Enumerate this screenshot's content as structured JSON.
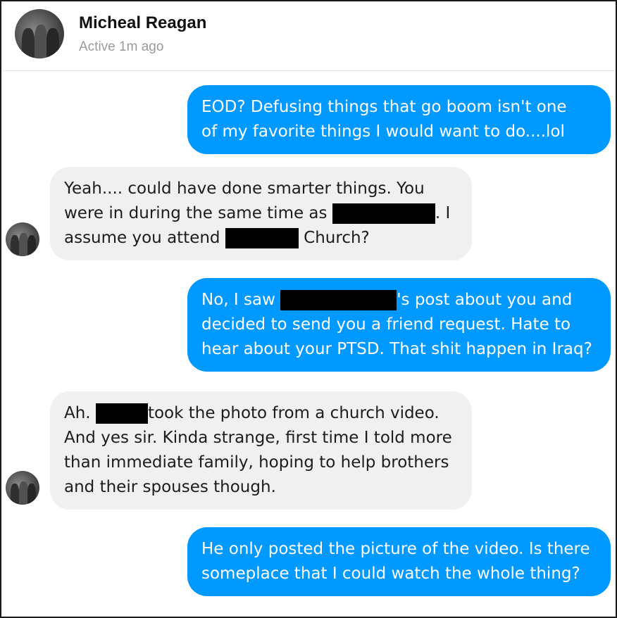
{
  "contact": {
    "name": "Micheal Reagan",
    "status": "Active 1m ago"
  },
  "messages": [
    {
      "direction": "sent",
      "lines": [
        "EOD? Defusing things that go boom  isn't one",
        "of my favorite things I would want to do....lol"
      ]
    },
    {
      "direction": "received",
      "parts": {
        "l1": "Yeah.... could have done smarter things. You",
        "l2a": "were in during the same time as ",
        "l2b": ". I",
        "l3a": "assume you attend ",
        "l3b": " Church?"
      }
    },
    {
      "direction": "sent",
      "parts": {
        "l1a": "No, I saw ",
        "l1b": "'s post about you and",
        "l2": "decided to send you a friend request. Hate to",
        "l3": "hear about your PTSD. That shit happen in Iraq?"
      }
    },
    {
      "direction": "received",
      "parts": {
        "l1a": "Ah. ",
        "l1b": "took the photo from a church video.",
        "l2": "And yes sir. Kinda strange, first time I told more",
        "l3": "than immediate family, hoping to help brothers",
        "l4": "and their spouses though."
      }
    },
    {
      "direction": "sent",
      "lines": [
        "He only posted the picture of the video. Is there",
        "someplace that I could watch the whole thing?"
      ]
    }
  ],
  "colors": {
    "sent_bubble": "#0099ff",
    "received_bubble": "#f1f0f0",
    "redaction": "#000000"
  }
}
